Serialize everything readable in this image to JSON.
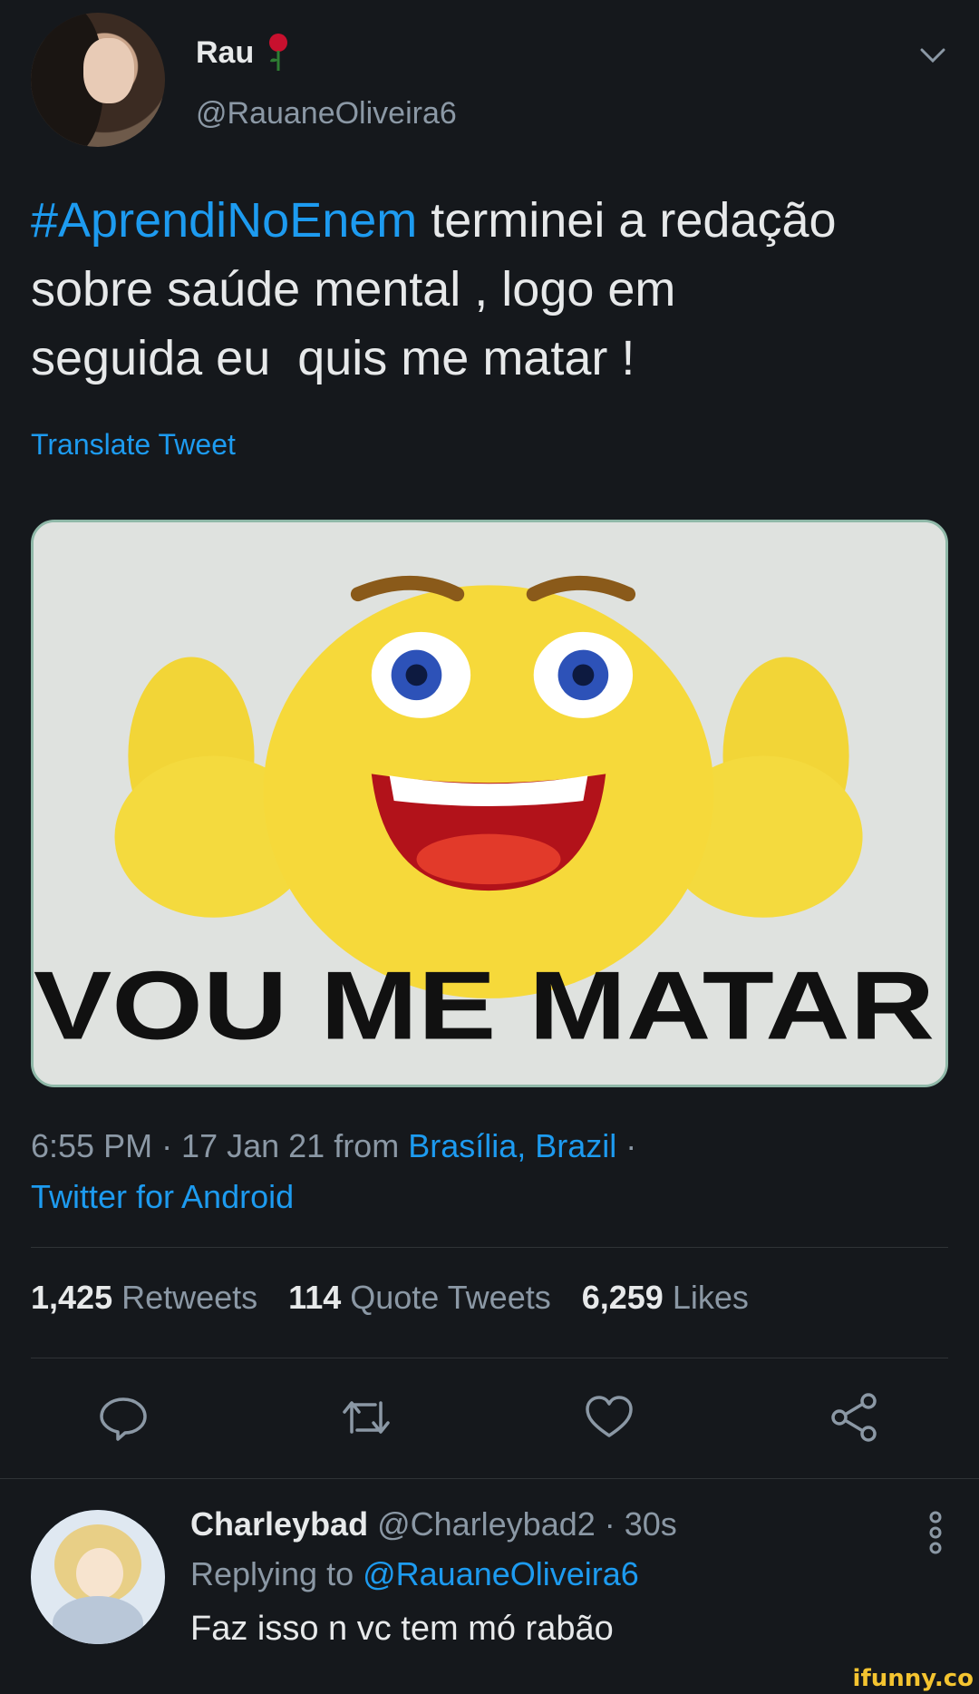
{
  "tweet": {
    "name": "Rau",
    "handle": "@RauaneOliveira6",
    "hashtag": "#AprendiNoEnem",
    "text_line1_rest": " terminei a redação",
    "text_line2": "sobre saúde mental , logo em",
    "text_line3": "seguida eu  quis me matar !",
    "translate_label": "Translate Tweet",
    "media_caption": "VOU ME MATAR",
    "time": "6:55 PM · 17 Jan 21 from ",
    "location": "Brasília, Brazil",
    "location_sep": " ·",
    "source": "Twitter for Android"
  },
  "stats": {
    "retweets_count": "1,425",
    "retweets_label": "Retweets",
    "quotes_count": "114",
    "quotes_label": "Quote Tweets",
    "likes_count": "6,259",
    "likes_label": "Likes"
  },
  "actions": [
    "reply-icon",
    "retweet-icon",
    "like-icon",
    "share-icon"
  ],
  "reply": {
    "name": "Charleybad",
    "handle": "@Charleybad2 · 30s",
    "replying_prefix": "Replying to ",
    "replying_handle": "@RauaneOliveira6",
    "text": "Faz isso n vc tem mó rabão"
  },
  "watermark": "ifunny.co",
  "colors": {
    "background": "#15181c",
    "accent": "#1d9bf0",
    "muted": "#8b98a5",
    "text": "#e7e9ea"
  }
}
